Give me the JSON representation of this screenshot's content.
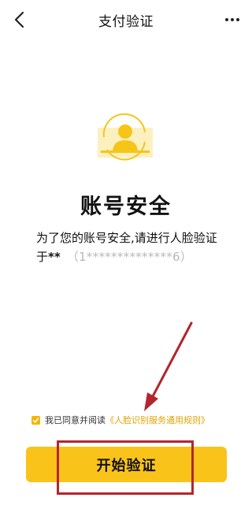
{
  "header": {
    "title": "支付验证",
    "back_icon": "back-chevron-icon",
    "more_icon": "more-dots-icon"
  },
  "hero": {
    "icon": "face-recognition-icon",
    "title": "账号安全",
    "desc_line1": "为了您的账号安全,请进行人脸验证",
    "desc_prefix": "于",
    "masked_name": "**",
    "masked_phone": "（1**************6）"
  },
  "agreement": {
    "checked": true,
    "text": "我已同意并阅读",
    "link": "《人脸识别服务通用规则》"
  },
  "action": {
    "start_label": "开始验证"
  },
  "colors": {
    "accent": "#f9c31a",
    "link": "#e3a300",
    "annotation": "#b3262d",
    "masked": "#b8b8b8"
  }
}
